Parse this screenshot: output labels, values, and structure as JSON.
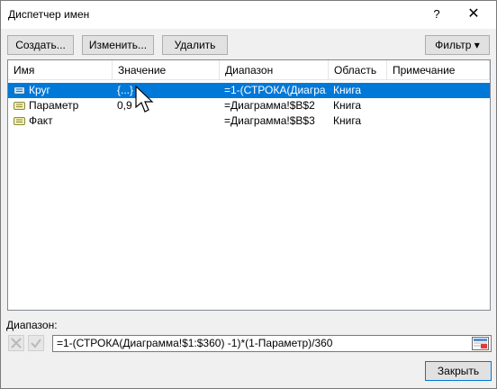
{
  "window": {
    "title": "Диспетчер имен",
    "help": "?",
    "close": "✕"
  },
  "toolbar": {
    "create": "Создать...",
    "edit": "Изменить...",
    "delete": "Удалить",
    "filter": "Фильтр ▾"
  },
  "table": {
    "columns": [
      "Имя",
      "Значение",
      "Диапазон",
      "Область",
      "Примечание"
    ],
    "rows": [
      {
        "name": "Круг",
        "value": "{...}",
        "range": "=1-(СТРОКА(Диагра...",
        "scope": "Книга",
        "note": "",
        "selected": true
      },
      {
        "name": "Параметр",
        "value": "0,9",
        "range": "=Диаграмма!$B$2",
        "scope": "Книга",
        "note": "",
        "selected": false
      },
      {
        "name": "Факт",
        "value": "",
        "range": "=Диаграмма!$B$3",
        "scope": "Книга",
        "note": "",
        "selected": false
      }
    ]
  },
  "range": {
    "label": "Диапазон:",
    "formula": "=1-(СТРОКА(Диаграмма!$1:$360) -1)*(1-Параметр)/360"
  },
  "footer": {
    "close": "Закрыть"
  },
  "colors": {
    "selection": "#0078d7",
    "dialog_bg": "#f0f0f0",
    "button_bg": "#e1e1e1"
  }
}
